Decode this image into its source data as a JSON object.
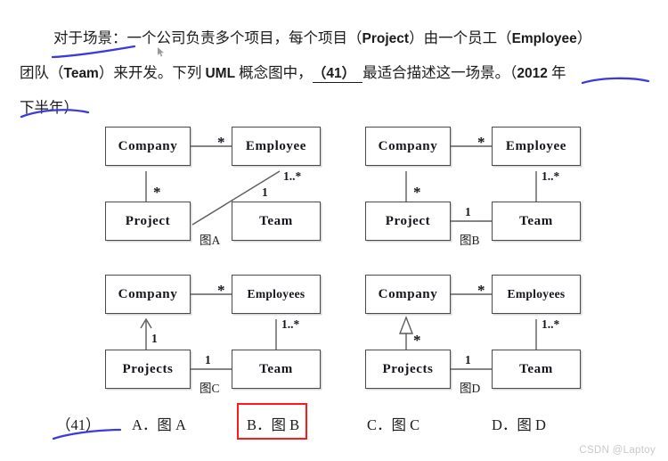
{
  "question": {
    "line1_prefix": "对于场景：一个公司负责多个项目，每个项目（",
    "line1_term1": "Project",
    "line1_mid": "）由一个员工（",
    "line1_term2": "Employee",
    "line1_suffix": "）",
    "line2_prefix": "团队（",
    "line2_term1": "Team",
    "line2_mid": "）来开发。下列 ",
    "line2_term2": "UML",
    "line2_mid2": " 概念图中，",
    "line2_blank": "（41）",
    "line2_after": "最适合描述这一场景。（",
    "line2_year": "2012",
    "line2_suffix": " 年",
    "line3": "下半年）"
  },
  "diagrams": [
    {
      "id": "A",
      "caption": "图A",
      "nodes": {
        "company": "Company",
        "employee": "Employee",
        "project": "Project",
        "team": "Team"
      },
      "multiplicities": {
        "company_employee": "*",
        "company_project": "*",
        "employee_project": "1..*",
        "team_cross": "1"
      }
    },
    {
      "id": "B",
      "caption": "图B",
      "nodes": {
        "company": "Company",
        "employee": "Employee",
        "project": "Project",
        "team": "Team"
      },
      "multiplicities": {
        "company_employee": "*",
        "company_project": "*",
        "employee_team": "1..*",
        "project_team": "1"
      }
    },
    {
      "id": "C",
      "caption": "图C",
      "nodes": {
        "company": "Company",
        "employee": "Employees",
        "project": "Projects",
        "team": "Team"
      },
      "multiplicities": {
        "company_employee": "*",
        "company_project": "1",
        "employee_team": "1..*",
        "project_team": "1"
      }
    },
    {
      "id": "D",
      "caption": "图D",
      "nodes": {
        "company": "Company",
        "employee": "Employees",
        "project": "Projects",
        "team": "Team"
      },
      "multiplicities": {
        "company_employee": "*",
        "company_project": "*",
        "employee_team": "1..*",
        "project_team": "1"
      }
    }
  ],
  "answers": {
    "number": "（41）",
    "a": "A．图 A",
    "b": "B．图 B",
    "c": "C．图 C",
    "d": "D．图 D",
    "selected": "B"
  },
  "watermark": "CSDN @Laptoy",
  "colors": {
    "annotation_blue": "#3b3bdd",
    "selection_red": "#ff1a1a",
    "box_stroke": "#4a4a4a",
    "text": "#1b1b1b"
  }
}
